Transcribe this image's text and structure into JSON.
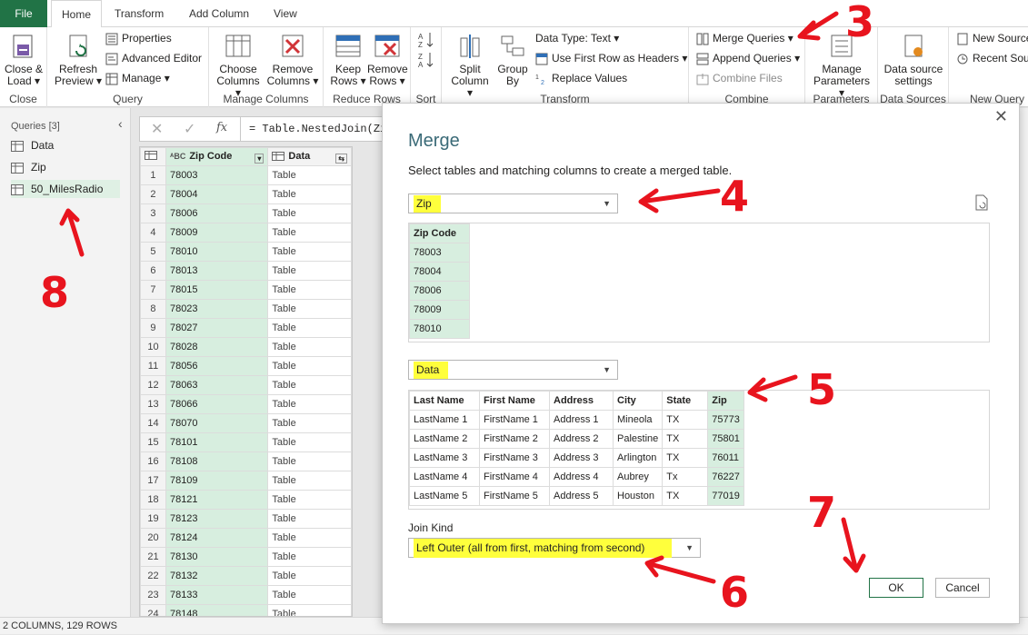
{
  "tabs": {
    "file": "File",
    "home": "Home",
    "transform": "Transform",
    "add_column": "Add Column",
    "view": "View"
  },
  "ribbon": {
    "close_load": "Close &",
    "close_load2": "Load",
    "refresh": "Refresh",
    "refresh2": "Preview",
    "properties": "Properties",
    "advanced_editor": "Advanced Editor",
    "manage": "Manage",
    "choose_columns": "Choose",
    "choose_columns2": "Columns",
    "remove_columns": "Remove",
    "remove_columns2": "Columns",
    "keep_rows": "Keep",
    "keep_rows2": "Rows",
    "remove_rows": "Remove",
    "remove_rows2": "Rows",
    "split_column": "Split",
    "split_column2": "Column",
    "group_by": "Group",
    "group_by2": "By",
    "data_type": "Data Type: Text",
    "first_row_headers": "Use First Row as Headers",
    "replace_values": "Replace Values",
    "merge_queries": "Merge Queries",
    "append_queries": "Append Queries",
    "combine_files": "Combine Files",
    "manage_parameters": "Manage",
    "manage_parameters2": "Parameters",
    "data_source_settings": "Data source",
    "data_source_settings2": "settings",
    "new_source": "New Source",
    "recent_sources": "Recent Sou",
    "groups": {
      "close": "Close",
      "query": "Query",
      "manage_columns": "Manage Columns",
      "reduce_rows": "Reduce Rows",
      "sort": "Sort",
      "transform": "Transform",
      "combine": "Combine",
      "parameters": "Parameters",
      "data_sources": "Data Sources",
      "new_query": "New Query"
    }
  },
  "queries_pane": {
    "header": "Queries [3]",
    "items": [
      "Data",
      "Zip",
      "50_MilesRadio"
    ]
  },
  "formula_bar": {
    "text": "= Table.NestedJoin(Zip"
  },
  "grid": {
    "columns": [
      "Zip Code",
      "Data"
    ],
    "rows": [
      [
        "1",
        "78003",
        "Table"
      ],
      [
        "2",
        "78004",
        "Table"
      ],
      [
        "3",
        "78006",
        "Table"
      ],
      [
        "4",
        "78009",
        "Table"
      ],
      [
        "5",
        "78010",
        "Table"
      ],
      [
        "6",
        "78013",
        "Table"
      ],
      [
        "7",
        "78015",
        "Table"
      ],
      [
        "8",
        "78023",
        "Table"
      ],
      [
        "9",
        "78027",
        "Table"
      ],
      [
        "10",
        "78028",
        "Table"
      ],
      [
        "11",
        "78056",
        "Table"
      ],
      [
        "12",
        "78063",
        "Table"
      ],
      [
        "13",
        "78066",
        "Table"
      ],
      [
        "14",
        "78070",
        "Table"
      ],
      [
        "15",
        "78101",
        "Table"
      ],
      [
        "16",
        "78108",
        "Table"
      ],
      [
        "17",
        "78109",
        "Table"
      ],
      [
        "18",
        "78121",
        "Table"
      ],
      [
        "19",
        "78123",
        "Table"
      ],
      [
        "20",
        "78124",
        "Table"
      ],
      [
        "21",
        "78130",
        "Table"
      ],
      [
        "22",
        "78132",
        "Table"
      ],
      [
        "23",
        "78133",
        "Table"
      ],
      [
        "24",
        "78148",
        "Table"
      ]
    ]
  },
  "status_bar": "2 COLUMNS, 129 ROWS",
  "dialog": {
    "title": "Merge",
    "subtitle": "Select tables and matching columns to create a merged table.",
    "first_table": "Zip",
    "first_preview": {
      "header": "Zip Code",
      "values": [
        "78003",
        "78004",
        "78006",
        "78009",
        "78010"
      ]
    },
    "second_table": "Data",
    "second_preview": {
      "headers": [
        "Last Name",
        "First Name",
        "Address",
        "City",
        "State",
        "Zip"
      ],
      "rows": [
        [
          "LastName 1",
          "FirstName 1",
          "Address 1",
          "Mineola",
          "TX",
          "75773"
        ],
        [
          "LastName 2",
          "FirstName 2",
          "Address 2",
          "Palestine",
          "TX",
          "75801"
        ],
        [
          "LastName 3",
          "FirstName 3",
          "Address 3",
          "Arlington",
          "TX",
          "76011"
        ],
        [
          "LastName 4",
          "FirstName 4",
          "Address 4",
          "Aubrey",
          "Tx",
          "76227"
        ],
        [
          "LastName 5",
          "FirstName 5",
          "Address 5",
          "Houston",
          "TX",
          "77019"
        ]
      ]
    },
    "join_kind_label": "Join Kind",
    "join_kind": "Left Outer (all from first, matching from second)",
    "ok": "OK",
    "cancel": "Cancel"
  },
  "annotations": [
    "3",
    "4",
    "5",
    "6",
    "7",
    "8"
  ],
  "colors": {
    "accent": "#217346",
    "highlight": "#ffff3c",
    "annotation": "#e8141e",
    "zip_column": "#d7eedf"
  }
}
